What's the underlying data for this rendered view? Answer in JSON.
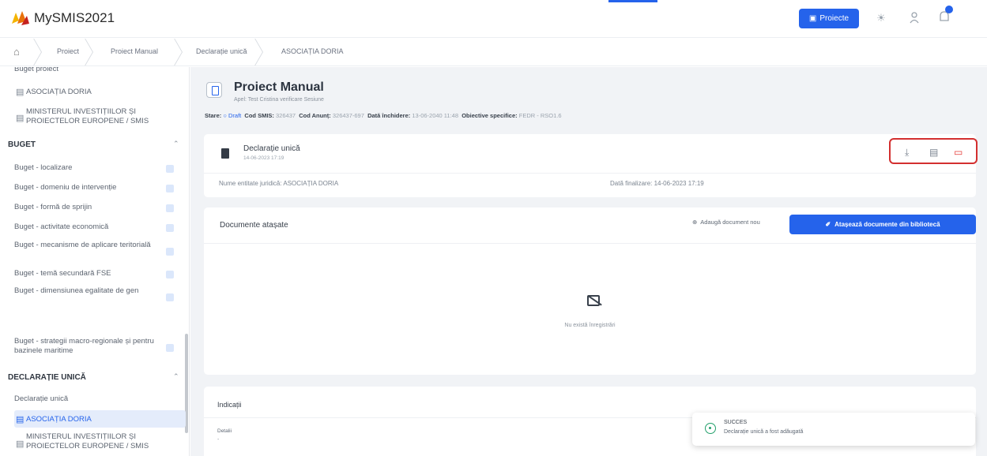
{
  "app": {
    "title": "MySMIS2021"
  },
  "header": {
    "projects_button": "Proiecte"
  },
  "breadcrumb": {
    "items": [
      "Proiect",
      "Proiect Manual",
      "Declarație unică",
      "ASOCIAȚIA DORIA"
    ]
  },
  "sidebar": {
    "top_label": "Buget proiect",
    "partners_top": [
      "ASOCIAȚIA DORIA",
      "MINISTERUL INVESTIȚIILOR ȘI PROIECTELOR EUROPENE / SMIS"
    ],
    "buget_section": "BUGET",
    "buget_items": [
      "Buget - localizare",
      "Buget - domeniu de intervenție",
      "Buget - formă de sprijin",
      "Buget - activitate economică",
      "Buget - mecanisme de aplicare teritorială",
      "Buget - temă secundară FSE",
      "Buget - dimensiunea egalitate de gen",
      "Buget - strategii macro-regionale și pentru bazinele maritime"
    ],
    "declaratie_section": "DECLARAȚIE UNICĂ",
    "declaratie_label": "Declarație unică",
    "declaratie_items": [
      "ASOCIAȚIA DORIA",
      "MINISTERUL INVESTIȚIILOR ȘI PROIECTELOR EUROPENE / SMIS"
    ]
  },
  "main": {
    "title": "Proiect Manual",
    "subtitle": "Apel: Test Cristina verificare Sesiune",
    "meta": {
      "stare_label": "Stare:",
      "stare_value": "Draft",
      "cod_smis_label": "Cod SMIS:",
      "cod_smis_value": "326437",
      "cod_anunt_label": "Cod Anunț:",
      "cod_anunt_value": "326437-697",
      "data_inchidere_label": "Dată închidere:",
      "data_inchidere_value": "13-06-2040 11:48",
      "obiective_label": "Obiective specifice:",
      "obiective_value": "FEDR - RSO1.6"
    },
    "document": {
      "name": "Declarație unică",
      "date": "14-06-2023 17:19",
      "entity": "Nume entitate juridică: ASOCIAȚIA DORIA",
      "finalized": "Dată finalizare: 14-06-2023 17:19"
    },
    "attachments": {
      "title": "Documente atașate",
      "add_new": "Adaugă document nou",
      "attach_from_library": "Atașează documente din bibliotecă",
      "empty": "Nu există înregistrări"
    },
    "indications": {
      "title": "Indicații",
      "details_label": "Detalii",
      "details_value": "-"
    }
  },
  "toast": {
    "title": "SUCCES",
    "message": "Declarație unică a fost adăugată"
  },
  "colors": {
    "primary": "#2563eb",
    "highlight": "#d32f2f",
    "success": "#22a06b"
  }
}
